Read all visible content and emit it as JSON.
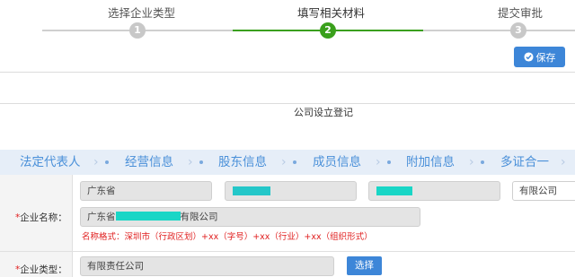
{
  "steps": [
    {
      "label": "选择企业类型",
      "number": "1",
      "active": false
    },
    {
      "label": "填写相关材料",
      "number": "2",
      "active": true
    },
    {
      "label": "提交审批",
      "number": "3",
      "active": false
    }
  ],
  "toolbar": {
    "save_label": "保存",
    "save_icon": "check-circle-icon"
  },
  "form_title": "公司设立登记",
  "section_tabs": [
    "法定代表人",
    "经营信息",
    "股东信息",
    "成员信息",
    "附加信息",
    "多证合一"
  ],
  "company_name": {
    "label": "企业名称：",
    "required_mark": "*",
    "province": "广东省",
    "org_form": "有限公司",
    "full_name_prefix": "广东省",
    "full_name_suffix": "有限公司",
    "hint": "名称格式：深圳市（行政区划）+xx（字号）+xx（行业）+xx（组织形式）"
  },
  "company_type": {
    "label": "企业类型：",
    "required_mark": "*",
    "value": "有限责任公司",
    "select_label": "选择"
  },
  "colors": {
    "accent": "#3d86d8",
    "step_active": "#3aa01c",
    "required": "#e02020",
    "tab_bg": "#e6eef8"
  }
}
